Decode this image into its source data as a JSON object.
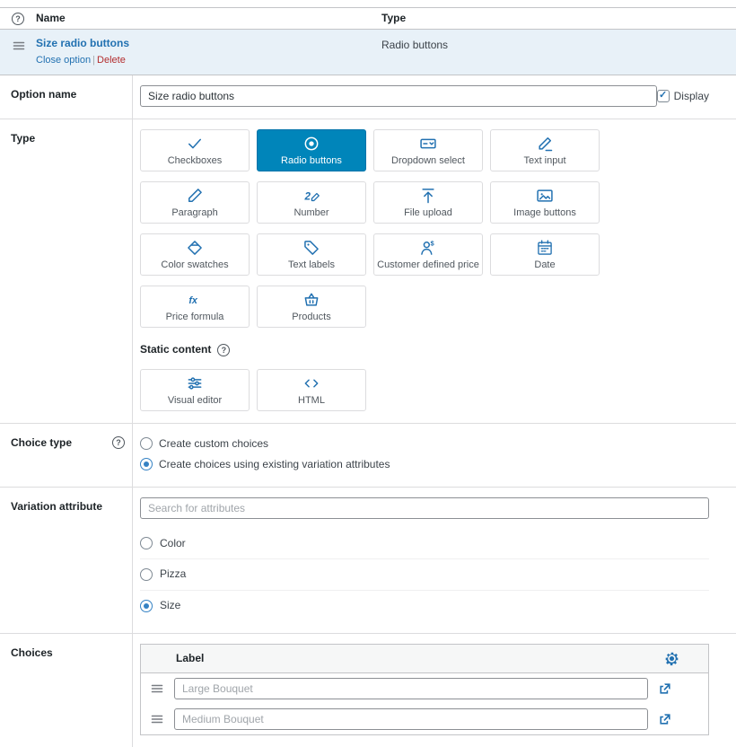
{
  "colors": {
    "accent": "#2271b1",
    "selected_tile": "#0085ba",
    "delete": "#b32d2e",
    "row_highlight": "#e8f1f8"
  },
  "columns": {
    "name": "Name",
    "type": "Type"
  },
  "option_row": {
    "title": "Size radio buttons",
    "close_label": "Close option",
    "separator": "|",
    "delete_label": "Delete",
    "type_value": "Radio buttons"
  },
  "option_name": {
    "label": "Option name",
    "value": "Size radio buttons",
    "display_label": "Display",
    "display_checked": true
  },
  "type_section": {
    "label": "Type",
    "tiles": [
      {
        "label": "Checkboxes",
        "icon": "check-icon",
        "selected": false
      },
      {
        "label": "Radio buttons",
        "icon": "radio-icon",
        "selected": true
      },
      {
        "label": "Dropdown select",
        "icon": "dropdown-icon",
        "selected": false
      },
      {
        "label": "Text input",
        "icon": "text-input-icon",
        "selected": false
      },
      {
        "label": "Paragraph",
        "icon": "paragraph-icon",
        "selected": false
      },
      {
        "label": "Number",
        "icon": "number-icon",
        "selected": false
      },
      {
        "label": "File upload",
        "icon": "file-upload-icon",
        "selected": false
      },
      {
        "label": "Image buttons",
        "icon": "image-buttons-icon",
        "selected": false
      },
      {
        "label": "Color swatches",
        "icon": "color-swatches-icon",
        "selected": false
      },
      {
        "label": "Text labels",
        "icon": "text-labels-icon",
        "selected": false
      },
      {
        "label": "Customer defined price",
        "icon": "customer-price-icon",
        "selected": false
      },
      {
        "label": "Date",
        "icon": "calendar-icon",
        "selected": false
      },
      {
        "label": "Price formula",
        "icon": "formula-icon",
        "selected": false
      },
      {
        "label": "Products",
        "icon": "products-icon",
        "selected": false
      }
    ],
    "static_content_label": "Static content",
    "static_tiles": [
      {
        "label": "Visual editor",
        "icon": "visual-editor-icon"
      },
      {
        "label": "HTML",
        "icon": "html-icon"
      }
    ]
  },
  "choice_type": {
    "label": "Choice type",
    "options": [
      {
        "label": "Create custom choices",
        "selected": false
      },
      {
        "label": "Create choices using existing variation attributes",
        "selected": true
      }
    ]
  },
  "variation_attribute": {
    "label": "Variation attribute",
    "search_placeholder": "Search for attributes",
    "options": [
      {
        "label": "Color",
        "selected": false
      },
      {
        "label": "Pizza",
        "selected": false
      },
      {
        "label": "Size",
        "selected": true
      }
    ]
  },
  "choices": {
    "label": "Choices",
    "column_label": "Label",
    "rows": [
      {
        "placeholder": "Large Bouquet"
      },
      {
        "placeholder": "Medium Bouquet"
      }
    ]
  }
}
